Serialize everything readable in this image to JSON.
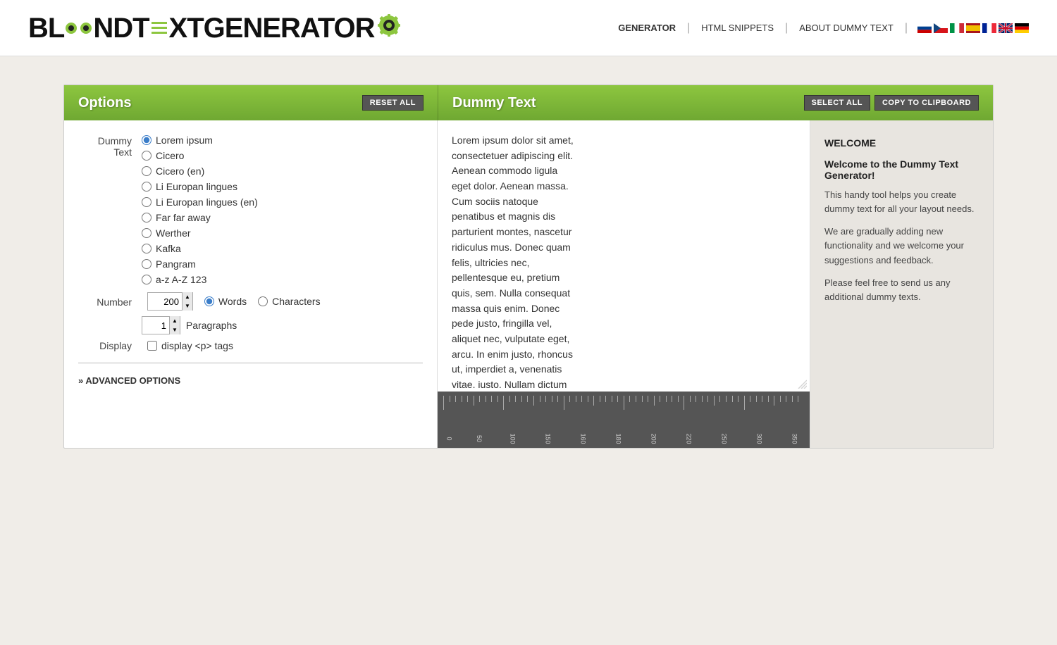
{
  "header": {
    "logo_text": "BL",
    "logo_suffix": "NDT",
    "logo_end": "XTGENERATOR",
    "nav": {
      "items": [
        {
          "label": "GENERATOR",
          "active": true
        },
        {
          "label": "HTML SNIPPETS",
          "active": false
        },
        {
          "label": "ABOUT DUMMY TEXT",
          "active": false
        }
      ]
    },
    "flags": [
      "🇷🇺",
      "🇨🇿",
      "🇮🇹",
      "🇪🇸",
      "🇫🇷",
      "🇬🇧",
      "🇩🇪"
    ]
  },
  "panel": {
    "options_title": "Options",
    "reset_label": "RESET ALL",
    "dummy_title": "Dummy Text",
    "select_all_label": "SELECT ALL",
    "copy_label": "COPY TO CLIPBOARD"
  },
  "options": {
    "dummy_text_label": "Dummy Text",
    "radio_options": [
      {
        "id": "r_lorem",
        "label": "Lorem ipsum",
        "checked": true
      },
      {
        "id": "r_cicero",
        "label": "Cicero",
        "checked": false
      },
      {
        "id": "r_cicero_en",
        "label": "Cicero (en)",
        "checked": false
      },
      {
        "id": "r_li_eu",
        "label": "Li Europan lingues",
        "checked": false
      },
      {
        "id": "r_li_eu_en",
        "label": "Li Europan lingues (en)",
        "checked": false
      },
      {
        "id": "r_far",
        "label": "Far far away",
        "checked": false
      },
      {
        "id": "r_werther",
        "label": "Werther",
        "checked": false
      },
      {
        "id": "r_kafka",
        "label": "Kafka",
        "checked": false
      },
      {
        "id": "r_pangram",
        "label": "Pangram",
        "checked": false
      },
      {
        "id": "r_az",
        "label": "a-z A-Z 123",
        "checked": false
      }
    ],
    "number_label": "Number",
    "number_value": "200",
    "words_label": "Words",
    "characters_label": "Characters",
    "paragraphs_label": "Paragraphs",
    "paragraphs_value": "1",
    "display_label": "Display",
    "display_checkbox_label": "display <p> tags",
    "advanced_label": "» ADVANCED OPTIONS"
  },
  "dummy_text": {
    "content": "Lorem ipsum dolor sit amet, consectetuer adipiscing elit. Aenean commodo ligula eget dolor. Aenean massa. Cum sociis natoque penatibus et magnis dis parturient montes, nascetur ridiculus mus. Donec quam felis, ultricies nec, pellentesque eu, pretium quis, sem. Nulla consequat massa quis enim. Donec pede justo, fringilla vel, aliquet nec, vulputate eget, arcu. In enim justo, rhoncus ut, imperdiet a, venenatis vitae, justo. Nullam dictum felis eu pede mollis pretium. Integer tincidunt. Cras dapibus. Vivamus elementum semper nisi. Aenean vulputate eleifend tellus. Aenean leo ligula, porttitor eu, consequat vitae, eleifend ac, enim. Aliquam lorem ante, dapibus in, viverra quis, feugiat a, tellus. Phasellus viverra nulla ut metus varius laoreet. Quisque rutrum. Aenean imperdiet. Etiam ultricies nisi vel augue. Curabitur ullamcorper ultricies nisi. Nam eget dui. Etiam rhoncus. Maecenas tempus, tellus eget condimentum rhoncus, sem quam semper libero, sit amet adipiscing sem neque sed ipsum. Nam quam nunc, blandit vel, luctus pulvinar, hendrerit id, lorem. Maecenas nec odio et ante tincidunt tempus. Donec vitae sapien ut libero venenatis faucibus. Nullam quis ante. Etiam sit amet orci eget eros faucibus tincidunt. Duis leo. Sed fringilla mauris sit amet nibh. Donec sodales sagittis magna. Sed consequat, leo eget bibendum sodales, augue velit cursus nunc,"
  },
  "ruler": {
    "numbers": [
      "0",
      "50",
      "100",
      "150",
      "160",
      "180",
      "200",
      "220",
      "250",
      "300",
      "350"
    ]
  },
  "welcome": {
    "section_title": "WELCOME",
    "heading": "Welcome to the Dummy Text Generator!",
    "paragraphs": [
      "This handy tool helps you create dummy text for all your layout needs.",
      "We are gradually adding new functionality and we welcome your suggestions and feedback.",
      "Please feel free to send us any additional dummy texts."
    ]
  }
}
